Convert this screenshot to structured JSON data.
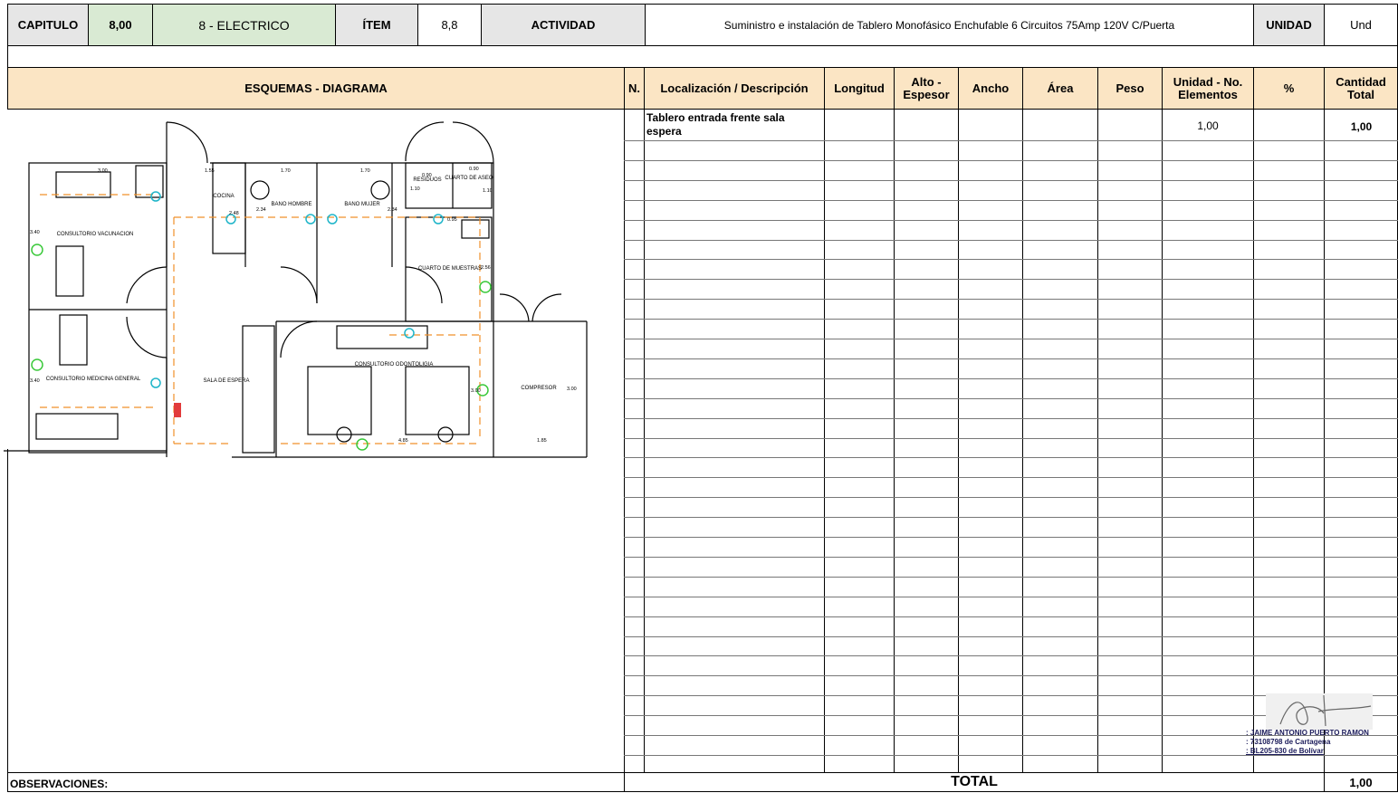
{
  "header": {
    "capitulo_label": "CAPITULO",
    "capitulo_value": "8,00",
    "capitulo_name": "8 - ELECTRICO",
    "item_label": "ÍTEM",
    "item_value": "8,8",
    "actividad_label": "ACTIVIDAD",
    "actividad_value": "Suministro e instalación de Tablero Monofásico Enchufable 6 Circuitos 75Amp 120V C/Puerta",
    "unidad_label": "UNIDAD",
    "unidad_value": "Und"
  },
  "columns": {
    "diagram": "ESQUEMAS - DIAGRAMA",
    "n": "N.",
    "localizacion": "Localización / Descripción",
    "longitud": "Longitud",
    "alto": "Alto - Espesor",
    "ancho": "Ancho",
    "area": "Área",
    "peso": "Peso",
    "unidad_no": "Unidad - No. Elementos",
    "porcentaje": "%",
    "cantidad": "Cantidad Total"
  },
  "rows": [
    {
      "n": "",
      "localizacion": "Tablero entrada frente sala espera",
      "longitud": "",
      "alto": "",
      "ancho": "",
      "area": "",
      "peso": "",
      "unidad_no": "1,00",
      "porcentaje": "",
      "cantidad": "1,00"
    }
  ],
  "plan_labels": {
    "consultorio_vacunacion": "CONSULTORIO VACUNACION",
    "consultorio_medicina": "CONSULTORIO MEDICINA GENERAL",
    "cocina": "COCINA",
    "bano_hombre": "BANO HOMBRE",
    "bano_mujer": "BANO MUJER",
    "residuos": "RESIDUOS",
    "cuarto_aseo": "CUARTO DE ASEO",
    "cuarto_muestras": "CUARTO DE MUESTRAS",
    "sala_espera": "SALA DE ESPERA",
    "consultorio_odontologia": "CONSULTORIO ODONTOLIGIA",
    "compresor": "COMPRESOR",
    "dims": [
      "3.00",
      "1.55",
      "1.70",
      "1.70",
      "0.90",
      "0.90",
      "1.10",
      "1.10",
      "2.48",
      "2.34",
      "2.34",
      "0.95",
      "2.56",
      "3.40",
      "3.40",
      "3.00",
      "3.00",
      "4.85",
      "1.85"
    ]
  },
  "signature": {
    "name": ": JAIME ANTONIO PUERTO RAMON",
    "id": ": 73108798 de Cartagena",
    "license": ": BL205-830 de Bolívar"
  },
  "footer": {
    "observaciones": "OBSERVACIONES:",
    "total_label": "TOTAL",
    "total_value": "1,00"
  },
  "colors": {
    "green_fill": "#d9ead3",
    "tan_fill": "#fbe5c4",
    "grey_fill": "#e6e6e6"
  }
}
